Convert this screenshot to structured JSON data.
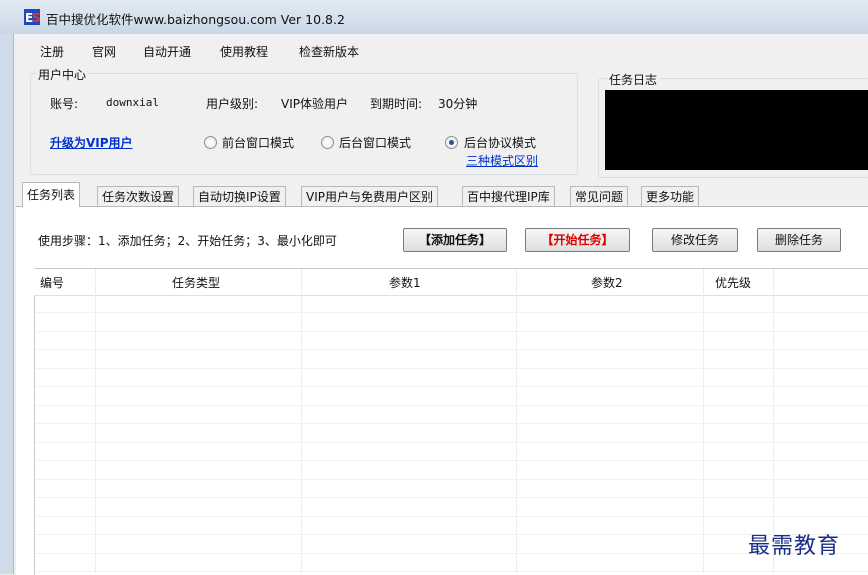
{
  "window": {
    "title": "百中搜优化软件www.baizhongsou.com Ver 10.8.2",
    "icon": "app-logo-icon"
  },
  "menu": {
    "items": [
      "注册",
      "官网",
      "自动开通",
      "使用教程",
      "检查新版本"
    ]
  },
  "user_center": {
    "group_label": "用户中心",
    "account_label": "账号:",
    "account_value": "downxial",
    "level_label": "用户级别:",
    "level_value": "VIP体验用户",
    "expiry_label": "到期时间:",
    "expiry_value": "30分钟",
    "upgrade_link": "升级为VIP用户",
    "modes": [
      {
        "label": "前台窗口模式",
        "selected": false
      },
      {
        "label": "后台窗口模式",
        "selected": false
      },
      {
        "label": "后台协议模式",
        "selected": true
      }
    ],
    "mode_diff_link": "三种模式区别"
  },
  "task_log": {
    "group_label": "任务日志"
  },
  "tabs": [
    {
      "label": "任务列表",
      "active": true
    },
    {
      "label": "任务次数设置",
      "active": false
    },
    {
      "label": "自动切换IP设置",
      "active": false
    },
    {
      "label": "VIP用户与免费用户区别",
      "active": false
    },
    {
      "label": "百中搜代理IP库",
      "active": false
    },
    {
      "label": "常见问题",
      "active": false
    },
    {
      "label": "更多功能",
      "active": false
    }
  ],
  "task_panel": {
    "steps_text": "使用步骤：1、添加任务；2、开始任务；3、最小化即可",
    "buttons": {
      "add": "【添加任务】",
      "start": "【开始任务】",
      "edit": "修改任务",
      "delete": "删除任务"
    },
    "columns": [
      "编号",
      "任务类型",
      "参数1",
      "参数2",
      "优先级"
    ],
    "rows": []
  },
  "watermark": "最需教育",
  "colors": {
    "link": "#0033cc",
    "start_button_text": "#e00000",
    "log_background": "#000000",
    "watermark": "#1a2f88"
  }
}
